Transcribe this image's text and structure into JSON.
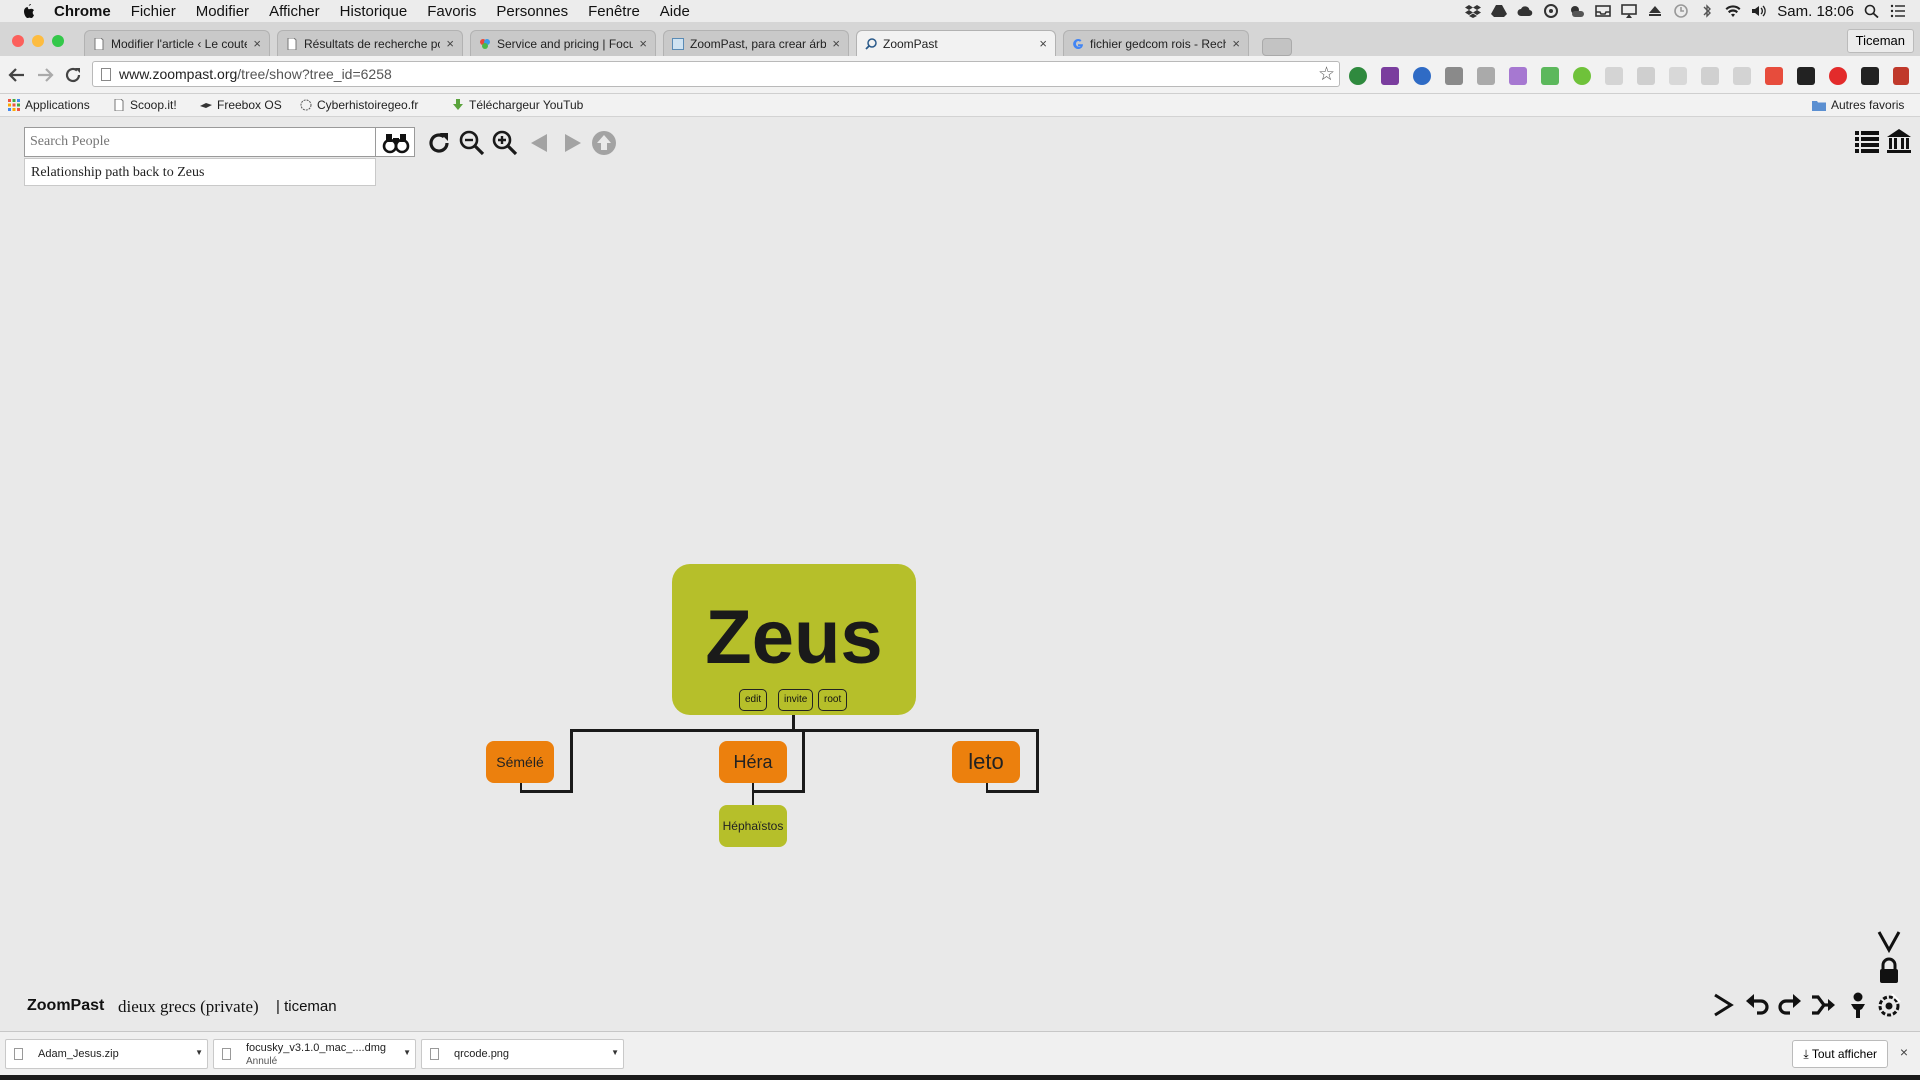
{
  "menubar": {
    "app": "Chrome",
    "items": [
      "Fichier",
      "Modifier",
      "Afficher",
      "Historique",
      "Favoris",
      "Personnes",
      "Fenêtre",
      "Aide"
    ],
    "clock": "Sam. 18:06"
  },
  "tabs": [
    {
      "title": "Modifier l'article ‹ Le coute"
    },
    {
      "title": "Résultats de recherche pou"
    },
    {
      "title": "Service and pricing | Focus"
    },
    {
      "title": "ZoomPast, para crear árbo"
    },
    {
      "title": "ZoomPast"
    },
    {
      "title": "fichier gedcom rois - Rech"
    }
  ],
  "profile": "Ticeman",
  "address": {
    "host": "www.zoompast.org",
    "path": "/tree/show?tree_id=6258"
  },
  "bookmarks": {
    "items": [
      "Applications",
      "Scoop.it!",
      "Freebox OS",
      "Cyberhistoiregeo.fr",
      "Téléchargeur YouTub"
    ],
    "other": "Autres favoris"
  },
  "search": {
    "placeholder": "Search People",
    "suggestion": "Relationship path back to Zeus"
  },
  "tree": {
    "root": {
      "name": "Zeus",
      "actions": [
        "edit",
        "invite",
        "root"
      ]
    },
    "children": [
      {
        "name": "Sémélé",
        "color": "#ec800d"
      },
      {
        "name": "Héra",
        "color": "#ec800d"
      },
      {
        "name": "leto",
        "color": "#ec800d"
      }
    ],
    "grandchild": {
      "name": "Héphaïstos",
      "color": "#b6bf2a"
    }
  },
  "footer": {
    "logo": "ZoomPast",
    "tree_name": "dieux grecs (private)",
    "separator": "|",
    "user": "ticeman"
  },
  "downloads": {
    "items": [
      {
        "name": "Adam_Jesus.zip",
        "status": ""
      },
      {
        "name": "focusky_v3.1.0_mac_....dmg",
        "status": "Annulé"
      },
      {
        "name": "qrcode.png",
        "status": ""
      }
    ],
    "show_all": "Tout afficher"
  },
  "colors": {
    "olive": "#b6bf2a",
    "orange": "#ec800d",
    "page_bg": "#e9e9e9"
  }
}
